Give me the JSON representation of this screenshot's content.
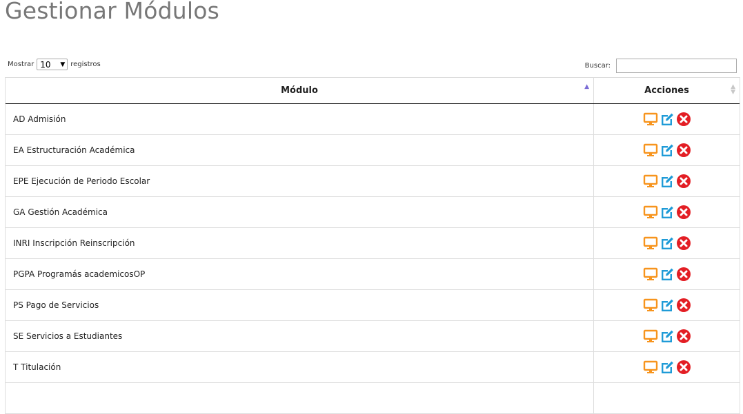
{
  "page": {
    "title": "Gestionar Módulos"
  },
  "length_control": {
    "prefix": "Mostrar",
    "value": "10",
    "suffix": "registros"
  },
  "search": {
    "label": "Buscar:",
    "value": ""
  },
  "table": {
    "headers": {
      "module": "Módulo",
      "actions": "Acciones"
    },
    "rows": [
      {
        "module": "AD Admisión"
      },
      {
        "module": "EA Estructuración Académica"
      },
      {
        "module": "EPE Ejecución de Periodo Escolar"
      },
      {
        "module": "GA Gestión Académica"
      },
      {
        "module": "INRI Inscripción Reinscripción"
      },
      {
        "module": "PGPA Programás academicosOP"
      },
      {
        "module": "PS Pago de Servicios"
      },
      {
        "module": "SE Servicios a Estudiantes"
      },
      {
        "module": "T Titulación"
      },
      {
        "module": ""
      }
    ]
  },
  "icons": {
    "view": "monitor-icon",
    "edit": "edit-icon",
    "delete": "delete-icon"
  },
  "colors": {
    "view": "#f7941d",
    "edit": "#1f9bd7",
    "delete": "#e31e24",
    "sort_active": "#7b6cd6"
  }
}
